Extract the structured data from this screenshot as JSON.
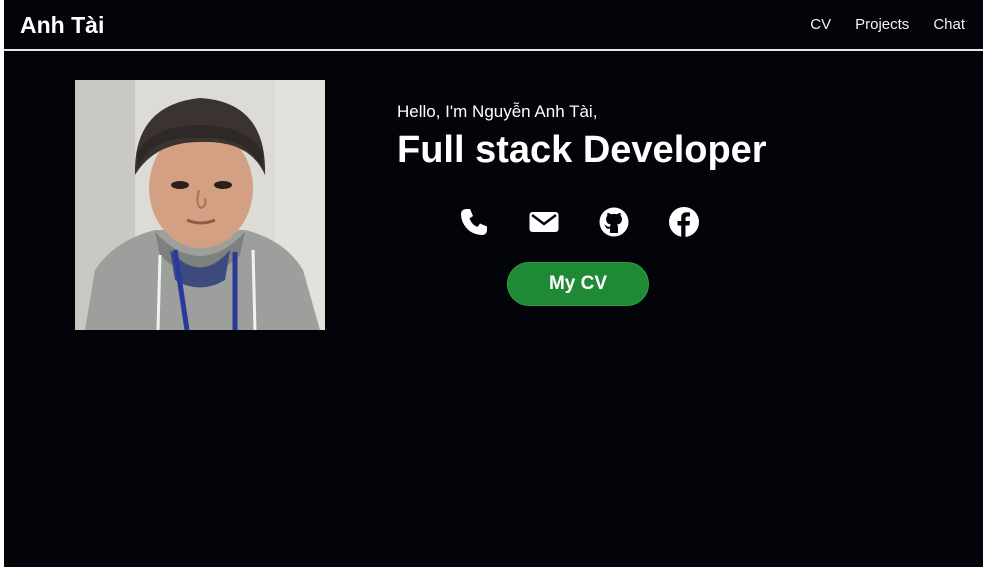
{
  "brand": "Anh Tài",
  "nav": {
    "items": [
      {
        "label": "CV"
      },
      {
        "label": "Projects"
      },
      {
        "label": "Chat"
      }
    ]
  },
  "hero": {
    "greeting": "Hello, I'm Nguyễn Anh Tài,",
    "role": "Full stack Developer",
    "cv_button": "My CV",
    "socials": [
      {
        "icon": "phone-icon"
      },
      {
        "icon": "email-icon"
      },
      {
        "icon": "github-icon"
      },
      {
        "icon": "facebook-icon"
      }
    ]
  },
  "colors": {
    "background": "#02040a",
    "accent": "#1f8a35",
    "text": "#ffffff"
  }
}
